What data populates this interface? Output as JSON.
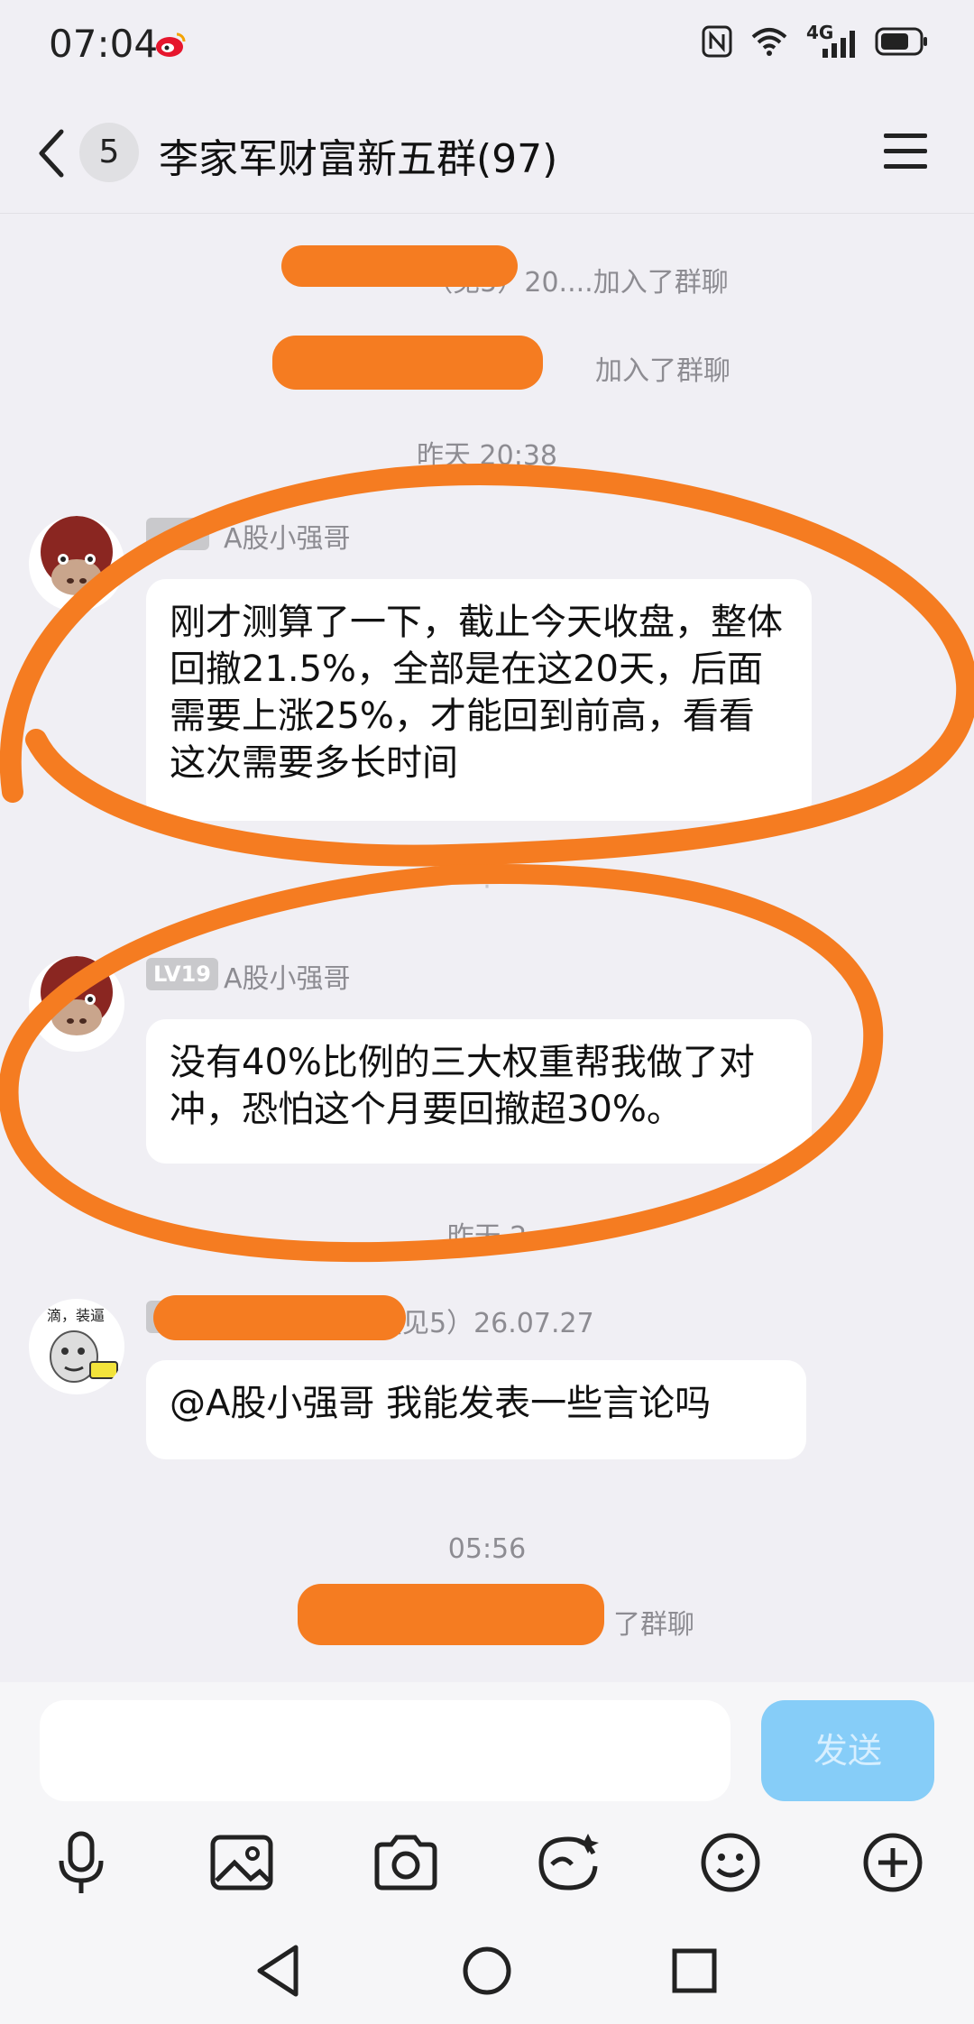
{
  "status_bar": {
    "time": "07:04",
    "network": "4G"
  },
  "header": {
    "badge_count": "5",
    "title": "李家军财富新五群(97)"
  },
  "system_messages": [
    {
      "visible_text": "（见5）20....加入了群聊"
    },
    {
      "visible_text": "加入了群聊"
    }
  ],
  "time_labels": [
    "昨天 20:38",
    "昨天 2",
    "05:56"
  ],
  "messages": [
    {
      "level": "",
      "sender": "A股小强哥",
      "text": "刚才测算了一下，截止今天收盘，整体回撤21.5%，全部是在这20天，后面需要上涨25%，才能回到前高，看看这次需要多长时间"
    },
    {
      "level": "LV19",
      "sender": "A股小强哥",
      "text": "没有40%比例的三大权重帮我做了对冲，恐怕这个月要回撤超30%。"
    },
    {
      "level": "LV",
      "sender": "（见5）26.07.27",
      "text": "@A股小强哥 我能发表一些言论吗"
    }
  ],
  "last_system": "了群聊",
  "input": {
    "placeholder": "",
    "send_label": "发送"
  },
  "toolbar": [
    "mic-icon",
    "image-icon",
    "camera-icon",
    "sticker-icon",
    "emoji-icon",
    "plus-icon"
  ],
  "colors": {
    "annotation": "#f57c21",
    "send_button": "#86cdf8",
    "background": "#f0eff4"
  }
}
